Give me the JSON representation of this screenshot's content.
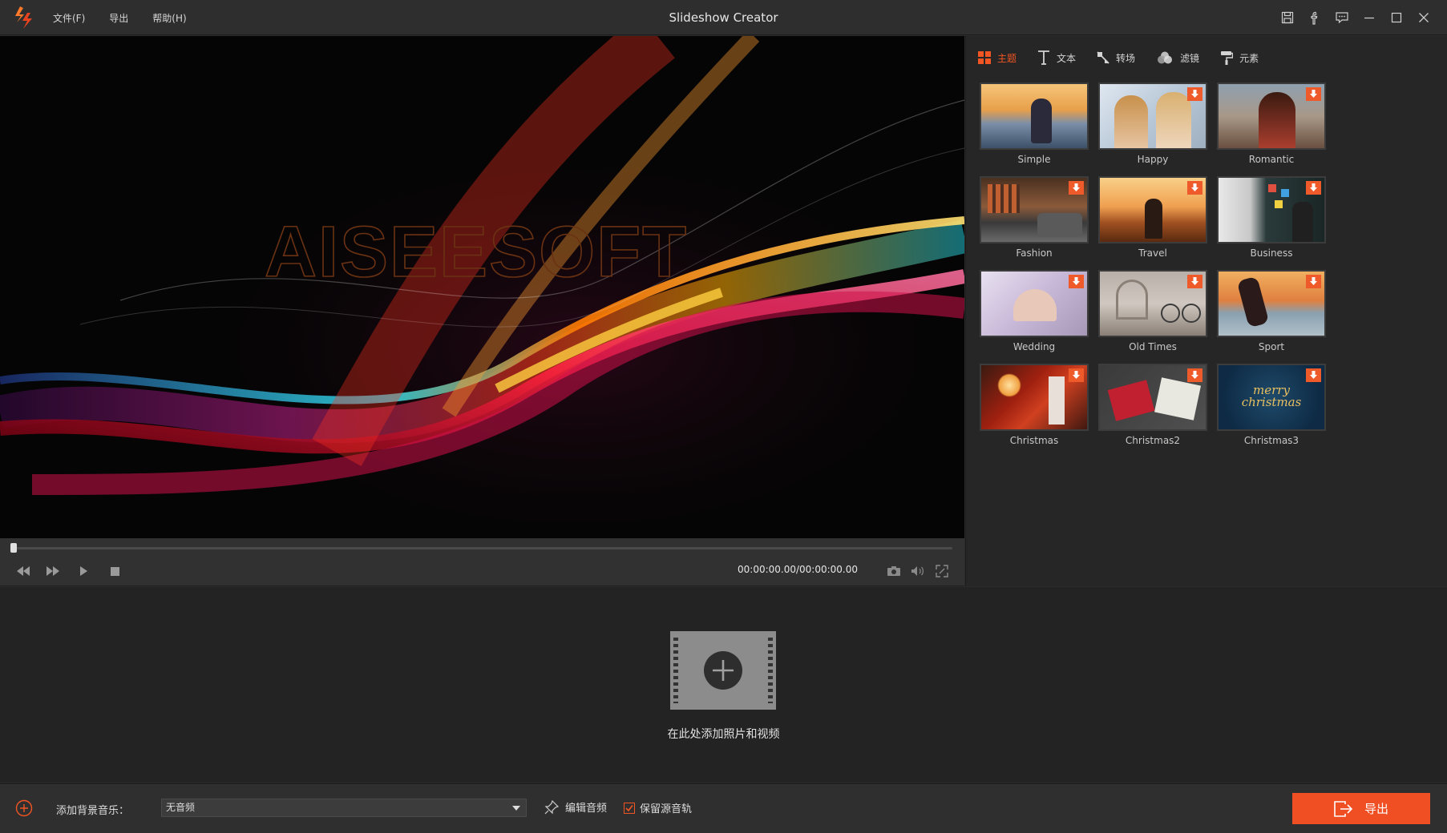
{
  "app": {
    "title": "Slideshow Creator"
  },
  "menu": {
    "file": "文件(F)",
    "export": "导出",
    "help": "帮助(H)"
  },
  "preview": {
    "watermark": "AISEESOFT"
  },
  "player": {
    "time": "00:00:00.00/00:00:00.00",
    "progress": 0
  },
  "tabs": [
    {
      "label": "主题",
      "icon": "grid-icon",
      "active": true
    },
    {
      "label": "文本",
      "icon": "text-icon",
      "active": false
    },
    {
      "label": "转场",
      "icon": "transition-icon",
      "active": false
    },
    {
      "label": "滤镜",
      "icon": "filter-icon",
      "active": false
    },
    {
      "label": "元素",
      "icon": "paint-roller-icon",
      "active": false
    }
  ],
  "themes": [
    {
      "name": "Simple",
      "downloadable": false
    },
    {
      "name": "Happy",
      "downloadable": true
    },
    {
      "name": "Romantic",
      "downloadable": true
    },
    {
      "name": "Fashion",
      "downloadable": true
    },
    {
      "name": "Travel",
      "downloadable": true
    },
    {
      "name": "Business",
      "downloadable": true
    },
    {
      "name": "Wedding",
      "downloadable": true
    },
    {
      "name": "Old Times",
      "downloadable": true
    },
    {
      "name": "Sport",
      "downloadable": true
    },
    {
      "name": "Christmas",
      "downloadable": true
    },
    {
      "name": "Christmas2",
      "downloadable": true
    },
    {
      "name": "Christmas3",
      "downloadable": true,
      "thumb_text": "merry christmas"
    }
  ],
  "media": {
    "add_label": "在此处添加照片和视频"
  },
  "bottom": {
    "music_label": "添加背景音乐：",
    "music_value": "无音频",
    "edit_audio": "编辑音频",
    "keep_source": "保留源音轨",
    "keep_source_checked": true,
    "export_label": "导出"
  },
  "colors": {
    "accent": "#ef4f23",
    "background": "#2b2b2b",
    "panel": "#262626"
  }
}
